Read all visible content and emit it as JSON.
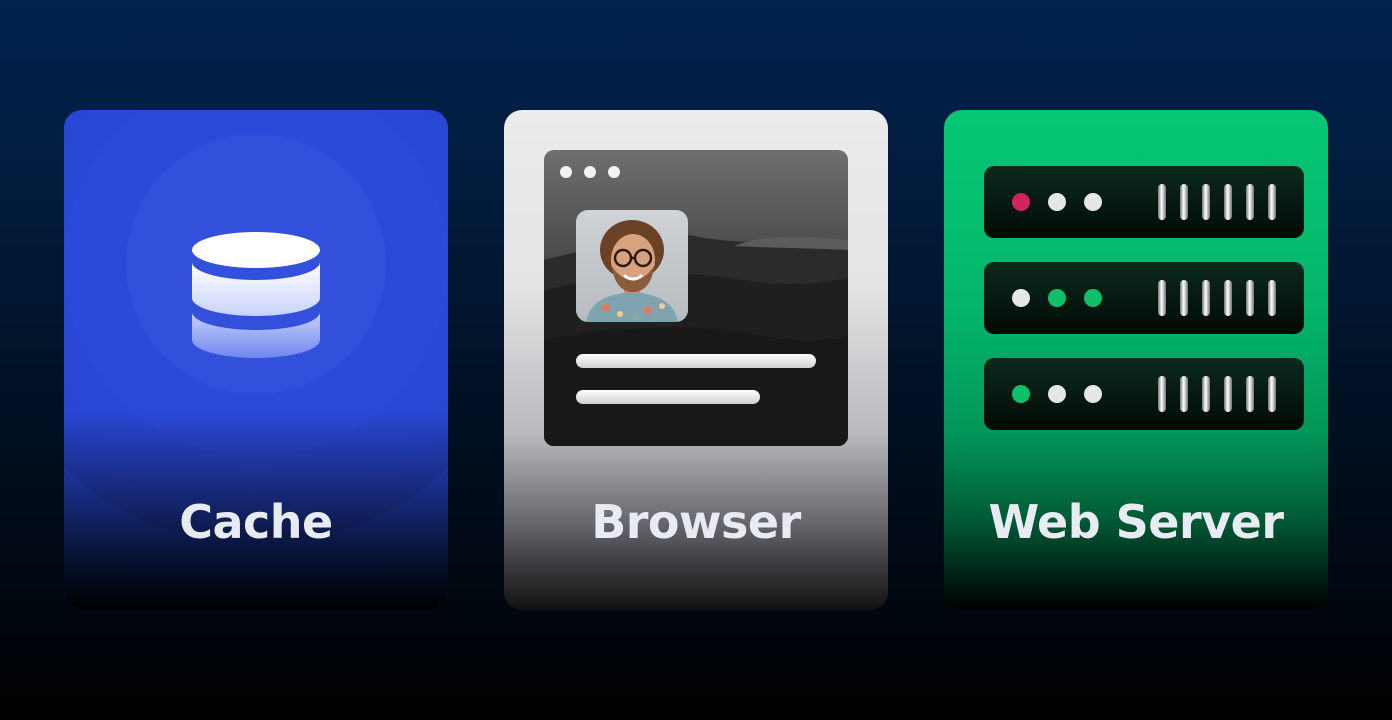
{
  "cards": [
    {
      "label": "Cache",
      "icon": "database-icon",
      "color": "#2a4de8"
    },
    {
      "label": "Browser",
      "icon": "browser-window-icon",
      "color": "#ececed"
    },
    {
      "label": "Web Server",
      "icon": "server-rack-icon",
      "color": "#05c874"
    }
  ],
  "server_racks": [
    {
      "leds": [
        "#d4245e",
        "#e6e6e6",
        "#e6e6e6"
      ]
    },
    {
      "leds": [
        "#e6e6e6",
        "#0fbf6a",
        "#0fbf6a"
      ]
    },
    {
      "leds": [
        "#0fbf6a",
        "#e6e6e6",
        "#e6e6e6"
      ]
    }
  ]
}
